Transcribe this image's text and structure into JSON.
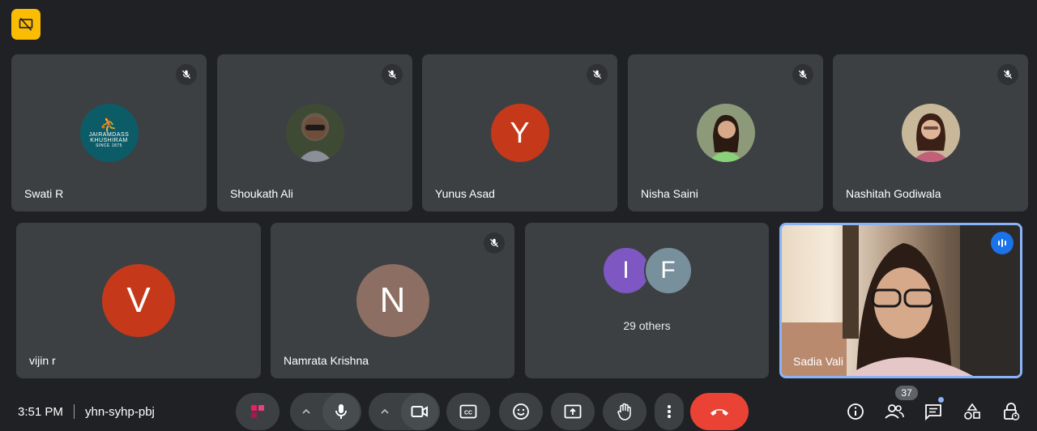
{
  "top_badge_icon": "presentation-off-icon",
  "row1": [
    {
      "name": "Swati R",
      "avatar": {
        "type": "logo",
        "bg": "#0c5c67",
        "line1": "JAIRAMDASS",
        "line2": "KHUSHIRAM",
        "line3": "SINCE 1875"
      },
      "muted": true
    },
    {
      "name": "Shoukath Ali",
      "avatar": {
        "type": "photo",
        "bg": "#4a4f3e"
      },
      "muted": true
    },
    {
      "name": "Yunus Asad",
      "avatar": {
        "type": "letter",
        "letter": "Y",
        "bg": "#c5391a"
      },
      "muted": true
    },
    {
      "name": "Nisha Saini",
      "avatar": {
        "type": "photo",
        "bg": "#8d9a7a"
      },
      "muted": true
    },
    {
      "name": "Nashitah Godiwala",
      "avatar": {
        "type": "photo",
        "bg": "#b09a7a"
      },
      "muted": true
    }
  ],
  "row2": [
    {
      "name": "vijin r",
      "avatar": {
        "type": "letter",
        "letter": "V",
        "bg": "#c5391a"
      },
      "muted": false
    },
    {
      "name": "Namrata Krishna",
      "avatar": {
        "type": "letter",
        "letter": "N",
        "bg": "#8d6e63"
      },
      "muted": true
    }
  ],
  "others": {
    "letters": [
      "I",
      "F"
    ],
    "colors": [
      "#7e57c2",
      "#78909c"
    ],
    "label": "29 others"
  },
  "self_video": {
    "name": "Sadia Vali",
    "speaking_icon": "audio-level-icon"
  },
  "bottom": {
    "time": "3:51 PM",
    "meeting_code": "yhn-syhp-pbj",
    "people_count": "37"
  },
  "colors": {
    "bg": "#202124",
    "tile": "#3c4043",
    "accent": "#8ab4f8",
    "end": "#ea4335",
    "badge": "#fbbc04"
  }
}
